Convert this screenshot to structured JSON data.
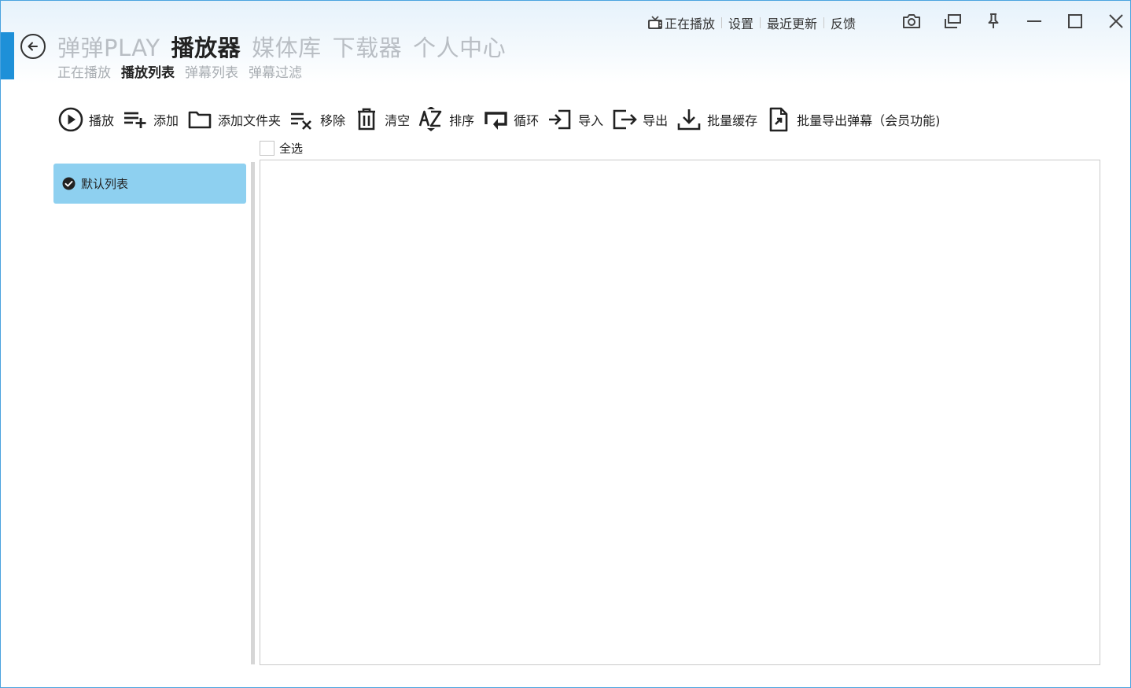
{
  "nav": {
    "tabs": [
      "弹弹PLAY",
      "播放器",
      "媒体库",
      "下载器",
      "个人中心"
    ],
    "active_tab": "播放器",
    "sub_tabs": [
      "正在播放",
      "播放列表",
      "弹幕列表",
      "弹幕过滤"
    ],
    "active_sub_tab": "播放列表"
  },
  "top_links": {
    "now_playing": "正在播放",
    "settings": "设置",
    "recent_updates": "最近更新",
    "feedback": "反馈"
  },
  "toolbar": {
    "play": "播放",
    "add": "添加",
    "add_folder": "添加文件夹",
    "remove": "移除",
    "clear": "清空",
    "sort": "排序",
    "loop": "循环",
    "import": "导入",
    "export": "导出",
    "batch_cache": "批量缓存",
    "batch_export_danmaku": "批量导出弹幕（会员功能)"
  },
  "select_all": {
    "label": "全选",
    "checked": false
  },
  "playlists": [
    {
      "name": "默认列表",
      "selected": true
    }
  ],
  "icons": {
    "back": "back-arrow-icon",
    "tv": "tv-icon",
    "camera": "camera-icon",
    "mini": "restore-windows-icon",
    "pin": "pin-icon",
    "min": "minimize-icon",
    "max": "maximize-icon",
    "close": "close-icon"
  },
  "colors": {
    "accent": "#1e90d8",
    "selected_item": "#8ed0f0",
    "inactive_nav": "#b9bec4"
  }
}
